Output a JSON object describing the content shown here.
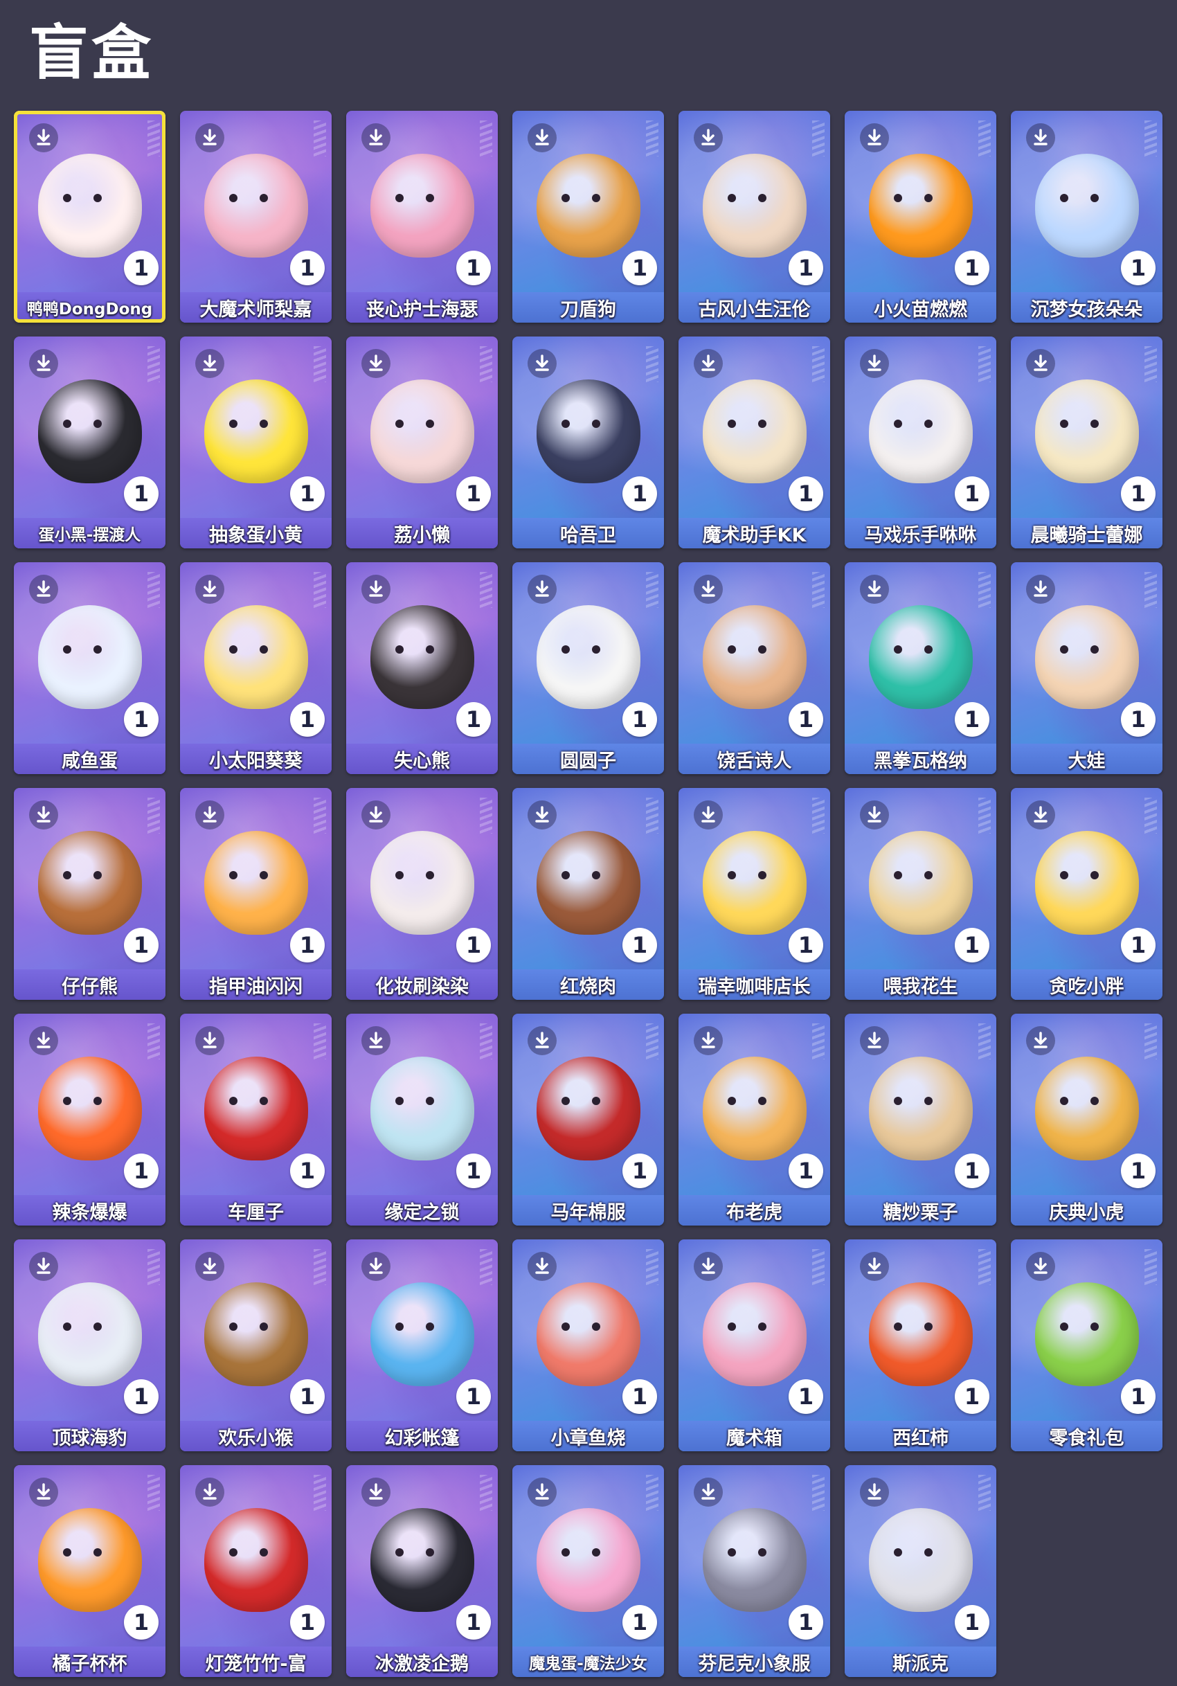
{
  "header": {
    "title": "盲盒"
  },
  "items": [
    {
      "name": "鸭鸭DongDong",
      "count": "1",
      "selected": true,
      "style": "violet",
      "figure": "#fff0f0"
    },
    {
      "name": "大魔术师梨嘉",
      "count": "1",
      "style": "violet",
      "figure": "#f6b4c8"
    },
    {
      "name": "丧心护士海瑟",
      "count": "1",
      "style": "violet",
      "figure": "#f3a3c0"
    },
    {
      "name": "刀盾狗",
      "count": "1",
      "style": "blue",
      "figure": "#e8a24a"
    },
    {
      "name": "古风小生汪伦",
      "count": "1",
      "style": "blue",
      "figure": "#f0d8c4"
    },
    {
      "name": "小火苗燃燃",
      "count": "1",
      "style": "blue",
      "figure": "#ff9a1e"
    },
    {
      "name": "沉梦女孩朵朵",
      "count": "1",
      "style": "blue",
      "figure": "#bcd8ff"
    },
    {
      "name": "蛋小黑-摆渡人",
      "count": "1",
      "style": "violet",
      "figure": "#2a2a30"
    },
    {
      "name": "抽象蛋小黄",
      "count": "1",
      "style": "violet",
      "figure": "#ffe53a"
    },
    {
      "name": "荔小懒",
      "count": "1",
      "style": "violet",
      "figure": "#f6d8d8"
    },
    {
      "name": "哈吾卫",
      "count": "1",
      "style": "blue",
      "figure": "#3a3f60"
    },
    {
      "name": "魔术助手KK",
      "count": "1",
      "style": "blue",
      "figure": "#f4e4c8"
    },
    {
      "name": "马戏乐手咻咻",
      "count": "1",
      "style": "blue",
      "figure": "#f4f0f0"
    },
    {
      "name": "晨曦骑士蕾娜",
      "count": "1",
      "style": "blue",
      "figure": "#f6e8c4"
    },
    {
      "name": "咸鱼蛋",
      "count": "1",
      "style": "violet",
      "figure": "#eaf2ff"
    },
    {
      "name": "小太阳葵葵",
      "count": "1",
      "style": "violet",
      "figure": "#ffe27a"
    },
    {
      "name": "失心熊",
      "count": "1",
      "style": "violet",
      "figure": "#3a3438"
    },
    {
      "name": "圆圆子",
      "count": "1",
      "style": "blue",
      "figure": "#f6f6f6"
    },
    {
      "name": "饶舌诗人",
      "count": "1",
      "style": "blue",
      "figure": "#e8b48a"
    },
    {
      "name": "黑拳瓦格纳",
      "count": "1",
      "style": "blue",
      "figure": "#2fc0a8"
    },
    {
      "name": "大娃",
      "count": "1",
      "style": "blue",
      "figure": "#f4d4b4"
    },
    {
      "name": "仔仔熊",
      "count": "1",
      "style": "violet",
      "figure": "#b86f3a"
    },
    {
      "name": "指甲油闪闪",
      "count": "1",
      "style": "violet",
      "figure": "#ffb24a"
    },
    {
      "name": "化妆刷染染",
      "count": "1",
      "style": "violet",
      "figure": "#f4ecec"
    },
    {
      "name": "红烧肉",
      "count": "1",
      "style": "blue",
      "figure": "#9a5a3a"
    },
    {
      "name": "瑞幸咖啡店长",
      "count": "1",
      "style": "blue",
      "figure": "#ffd85a"
    },
    {
      "name": "喂我花生",
      "count": "1",
      "style": "blue",
      "figure": "#f0d49a"
    },
    {
      "name": "贪吃小胖",
      "count": "1",
      "style": "blue",
      "figure": "#ffd85a"
    },
    {
      "name": "辣条爆爆",
      "count": "1",
      "style": "violet",
      "figure": "#ff6a2a"
    },
    {
      "name": "车厘子",
      "count": "1",
      "style": "violet",
      "figure": "#d42a2a"
    },
    {
      "name": "缘定之锁",
      "count": "1",
      "style": "violet",
      "figure": "#bfe4f2"
    },
    {
      "name": "马年棉服",
      "count": "1",
      "style": "blue",
      "figure": "#c42a2a"
    },
    {
      "name": "布老虎",
      "count": "1",
      "style": "blue",
      "figure": "#f4b45a"
    },
    {
      "name": "糖炒栗子",
      "count": "1",
      "style": "blue",
      "figure": "#e8c89a"
    },
    {
      "name": "庆典小虎",
      "count": "1",
      "style": "blue",
      "figure": "#f0b44a"
    },
    {
      "name": "顶球海豹",
      "count": "1",
      "style": "violet",
      "figure": "#e8eef6"
    },
    {
      "name": "欢乐小猴",
      "count": "1",
      "style": "violet",
      "figure": "#a8743a"
    },
    {
      "name": "幻彩帐篷",
      "count": "1",
      "style": "violet",
      "figure": "#5ab4f0"
    },
    {
      "name": "小章鱼烧",
      "count": "1",
      "style": "blue",
      "figure": "#f07a6a"
    },
    {
      "name": "魔术箱",
      "count": "1",
      "style": "blue",
      "figure": "#f4a4c0"
    },
    {
      "name": "西红柿",
      "count": "1",
      "style": "blue",
      "figure": "#f05a2a"
    },
    {
      "name": "零食礼包",
      "count": "1",
      "style": "blue",
      "figure": "#8ad04a"
    },
    {
      "name": "橘子杯杯",
      "count": "1",
      "style": "violet",
      "figure": "#ff9a2a"
    },
    {
      "name": "灯笼竹竹-富",
      "count": "1",
      "style": "violet",
      "figure": "#d42a2a"
    },
    {
      "name": "冰激凌企鹅",
      "count": "1",
      "style": "violet",
      "figure": "#2a2a34"
    },
    {
      "name": "魔鬼蛋-魔法少女",
      "count": "1",
      "style": "blue",
      "figure": "#f6a8d0"
    },
    {
      "name": "芬尼克小象服",
      "count": "1",
      "style": "blue",
      "figure": "#8a8aa0"
    },
    {
      "name": "斯派克",
      "count": "1",
      "style": "blue",
      "figure": "#e0e0e8"
    }
  ]
}
